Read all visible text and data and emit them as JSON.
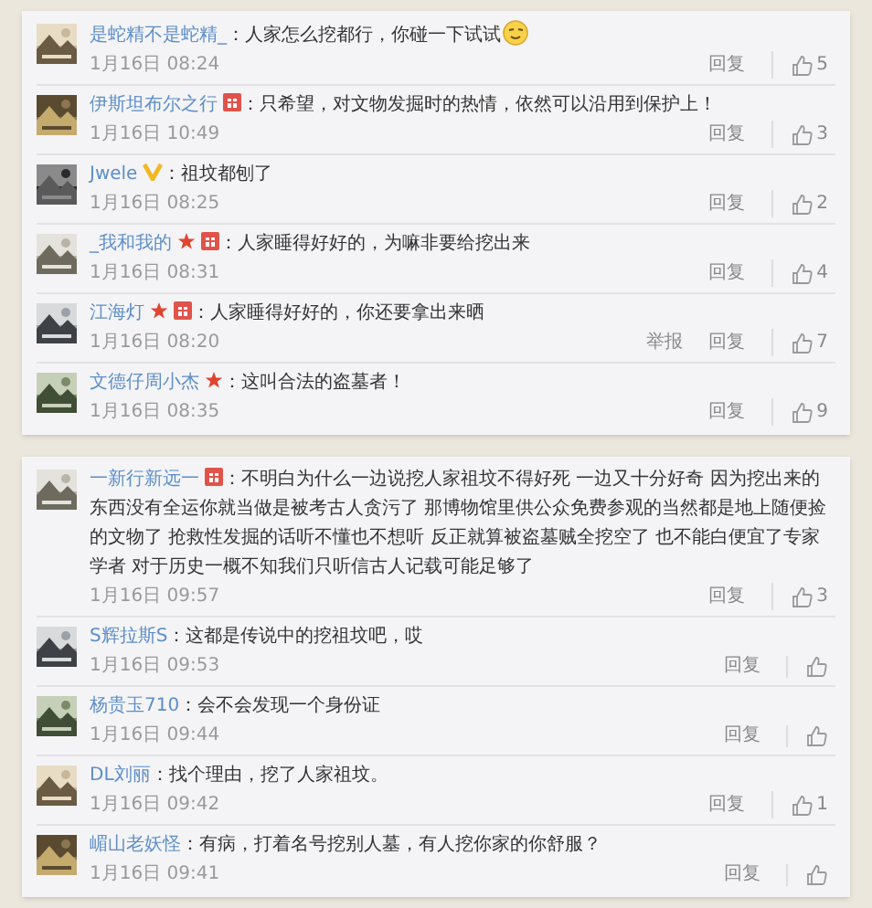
{
  "cards": [
    {
      "comments": [
        {
          "user": "是蛇精不是蛇精_",
          "text": "：人家怎么挖都行，你碰一下试试",
          "emoji": true,
          "time": "1月16日 08:24",
          "actions": [
            {
              "kind": "link",
              "label": "回复"
            },
            {
              "kind": "like",
              "count": "5"
            }
          ]
        },
        {
          "user": "伊斯坦布尔之行",
          "badges": [
            {
              "kind": "member"
            }
          ],
          "text": "：只希望，对文物发掘时的热情，依然可以沿用到保护上！",
          "time": "1月16日 10:49",
          "actions": [
            {
              "kind": "link",
              "label": "回复"
            },
            {
              "kind": "like",
              "count": "3"
            }
          ]
        },
        {
          "user": "Jwele",
          "badges": [
            {
              "kind": "verified"
            }
          ],
          "text": "：祖坟都刨了",
          "time": "1月16日 08:25",
          "actions": [
            {
              "kind": "link",
              "label": "回复"
            },
            {
              "kind": "like",
              "count": "2"
            }
          ]
        },
        {
          "user": "_我和我的",
          "badges": [
            {
              "kind": "star"
            },
            {
              "kind": "member"
            }
          ],
          "text": "：人家睡得好好的，为嘛非要给挖出来",
          "time": "1月16日 08:31",
          "actions": [
            {
              "kind": "link",
              "label": "回复"
            },
            {
              "kind": "like",
              "count": "4"
            }
          ]
        },
        {
          "user": "江海灯",
          "badges": [
            {
              "kind": "star"
            },
            {
              "kind": "member"
            }
          ],
          "text": "：人家睡得好好的，你还要拿出来晒",
          "time": "1月16日 08:20",
          "actions": [
            {
              "kind": "link",
              "label": "举报"
            },
            {
              "kind": "link",
              "label": "回复"
            },
            {
              "kind": "like",
              "count": "7"
            }
          ]
        },
        {
          "user": "文德仔周小杰",
          "badges": [
            {
              "kind": "star"
            }
          ],
          "text": "：这叫合法的盗墓者！",
          "time": "1月16日 08:35",
          "actions": [
            {
              "kind": "link",
              "label": "回复"
            },
            {
              "kind": "like",
              "count": "9"
            }
          ]
        }
      ]
    },
    {
      "comments": [
        {
          "user": "一新行新远一",
          "badges": [
            {
              "kind": "member"
            }
          ],
          "text": "：不明白为什么一边说挖人家祖坟不得好死 一边又十分好奇 因为挖出来的东西没有全运你就当做是被考古人贪污了 那博物馆里供公众免费参观的当然都是地上随便捡的文物了 抢救性发掘的话听不懂也不想听 反正就算被盗墓贼全挖空了 也不能白便宜了专家学者 对于历史一概不知我们只听信古人记载可能足够了",
          "time": "1月16日 09:57",
          "actions": [
            {
              "kind": "link",
              "label": "回复"
            },
            {
              "kind": "like",
              "count": "3"
            }
          ]
        },
        {
          "user": "S辉拉斯S",
          "text": "：这都是传说中的挖祖坟吧，哎",
          "time": "1月16日 09:53",
          "actions": [
            {
              "kind": "link",
              "label": "回复"
            },
            {
              "kind": "like"
            }
          ]
        },
        {
          "user": "杨贵玉710",
          "text": "：会不会发现一个身份证",
          "time": "1月16日 09:44",
          "actions": [
            {
              "kind": "link",
              "label": "回复"
            },
            {
              "kind": "like"
            }
          ]
        },
        {
          "user": "DL刘丽",
          "text": "：找个理由，挖了人家祖坟。",
          "time": "1月16日 09:42",
          "actions": [
            {
              "kind": "link",
              "label": "回复"
            },
            {
              "kind": "like",
              "count": "1"
            }
          ]
        },
        {
          "user": "嵋山老妖怪",
          "text": "：有病，打着名号挖别人墓，有人挖你家的你舒服？",
          "time": "1月16日 09:41",
          "actions": [
            {
              "kind": "link",
              "label": "回复"
            },
            {
              "kind": "like"
            }
          ]
        }
      ]
    }
  ]
}
